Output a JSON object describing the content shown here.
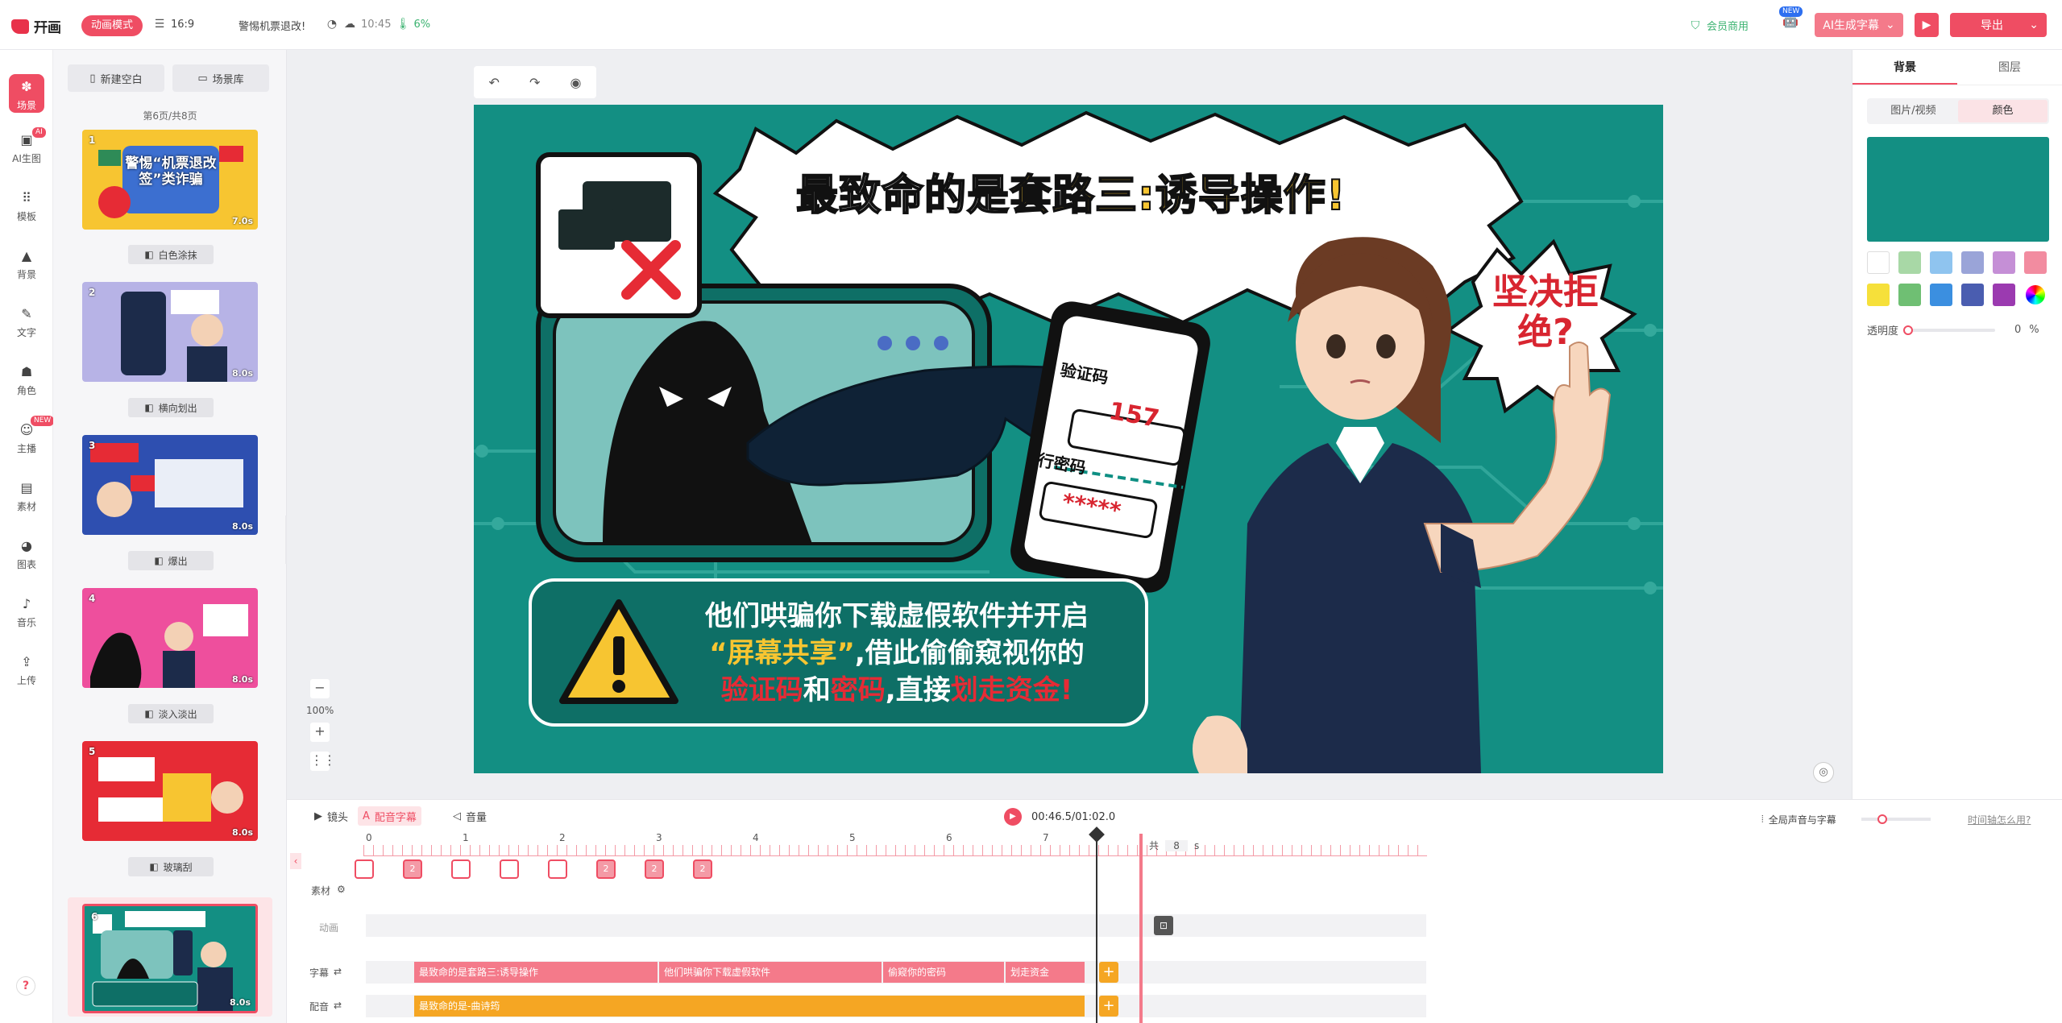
{
  "topbar": {
    "logo_text": "幵画",
    "mode_pill": "动画模式",
    "ratio": "16:9",
    "project_title": "警惕机票退改!",
    "time": "10:45",
    "temp": "6%",
    "member_label": "会员商用",
    "new_badge": "NEW",
    "ai_subtitle": "AI生成字幕",
    "export_label": "导出"
  },
  "leftnav": {
    "items": [
      {
        "label": "场景",
        "icon": "scene-icon"
      },
      {
        "label": "AI生图",
        "icon": "ai-image-icon",
        "badge": "AI"
      },
      {
        "label": "模板",
        "icon": "template-icon"
      },
      {
        "label": "背景",
        "icon": "background-icon"
      },
      {
        "label": "文字",
        "icon": "text-icon"
      },
      {
        "label": "角色",
        "icon": "character-icon"
      },
      {
        "label": "主播",
        "icon": "anchor-icon",
        "badge": "NEW"
      },
      {
        "label": "素材",
        "icon": "material-icon"
      },
      {
        "label": "图表",
        "icon": "chart-icon"
      },
      {
        "label": "音乐",
        "icon": "music-icon"
      },
      {
        "label": "上传",
        "icon": "upload-icon"
      }
    ],
    "help": "?"
  },
  "scenes": {
    "new_blank": "新建空白",
    "scene_library": "场景库",
    "page_count": "第6页/共8页",
    "thumbs": [
      {
        "num": "1",
        "duration": "7.0s",
        "title": "警惕“机票退改签”类诈骗",
        "bg": "#f7c531"
      },
      {
        "num": "2",
        "duration": "8.0s",
        "title": "",
        "bg": "#b7b3e6"
      },
      {
        "num": "3",
        "duration": "8.0s",
        "title": "",
        "bg": "#2e4fb0"
      },
      {
        "num": "4",
        "duration": "8.0s",
        "title": "",
        "bg": "#ee4f9d"
      },
      {
        "num": "5",
        "duration": "8.0s",
        "title": "",
        "bg": "#e62b35"
      },
      {
        "num": "6",
        "duration": "8.0s",
        "title": "",
        "bg": "#138f83"
      }
    ],
    "transitions": [
      "白色涂抹",
      "横向划出",
      "爆出",
      "淡入淡出",
      "玻璃刮"
    ]
  },
  "canvas": {
    "headline_white": "最致命的是",
    "headline_yellow": "套路三:诱导操作!",
    "bubble": "坚决拒绝?",
    "phone_label1": "验证码",
    "phone_code": "157",
    "phone_label2": "行密码",
    "phone_pin": "*****",
    "body_line1": "他们哄骗你下载虚假软件并开启",
    "body_line2_yellow": "“屏幕共享”",
    "body_line2_white": ",借此偷偷窥视你的",
    "body_line3_red1": "验证码",
    "body_line3_white1": "和",
    "body_line3_red2": "密码",
    "body_line3_white2": ",直接",
    "body_line3_red3": "划走资金!",
    "teal": "#138f83"
  },
  "zoom": {
    "minus": "−",
    "value": "100%",
    "plus": "+"
  },
  "rightpanel": {
    "tab_bg": "背景",
    "tab_layer": "图层",
    "sub_media": "图片/视频",
    "sub_color": "颜色",
    "opacity_label": "透明度",
    "opacity_value": "0",
    "opacity_unit": "%",
    "swatches_row1": [
      "#ffffff",
      "#a8d8a6",
      "#8fc4ef",
      "#9aa4d8",
      "#c58fd6",
      "#f28ca0"
    ],
    "swatches_row2": [
      "#f6e03a",
      "#6fbf73",
      "#3b8fe0",
      "#4a5db0",
      "#9b3ab0",
      "#rainbow"
    ]
  },
  "timeline": {
    "tab_camera": "镜头",
    "tab_subtitle": "配音字幕",
    "tab_volume": "音量",
    "time_display": "00:46.5/01:02.0",
    "global_label": "全局声音与字幕",
    "help_link": "时间轴怎么用?",
    "total_label": "共",
    "total_value": "8",
    "total_unit": "s",
    "ticks": [
      "0",
      "1",
      "2",
      "3",
      "4",
      "5",
      "6",
      "7"
    ],
    "lanes": {
      "material": "素材",
      "animation": "动画",
      "subtitle": "字幕",
      "voice": "配音"
    },
    "subtitle_blocks": [
      "最致命的是套路三:诱导操作",
      "他们哄骗你下载虚假软件",
      "偷窥你的密码",
      "划走资金"
    ],
    "voice_block": "最致命的是-曲诗筠",
    "chips": [
      "",
      "2",
      "",
      "",
      "",
      "2",
      "2",
      "2"
    ]
  }
}
